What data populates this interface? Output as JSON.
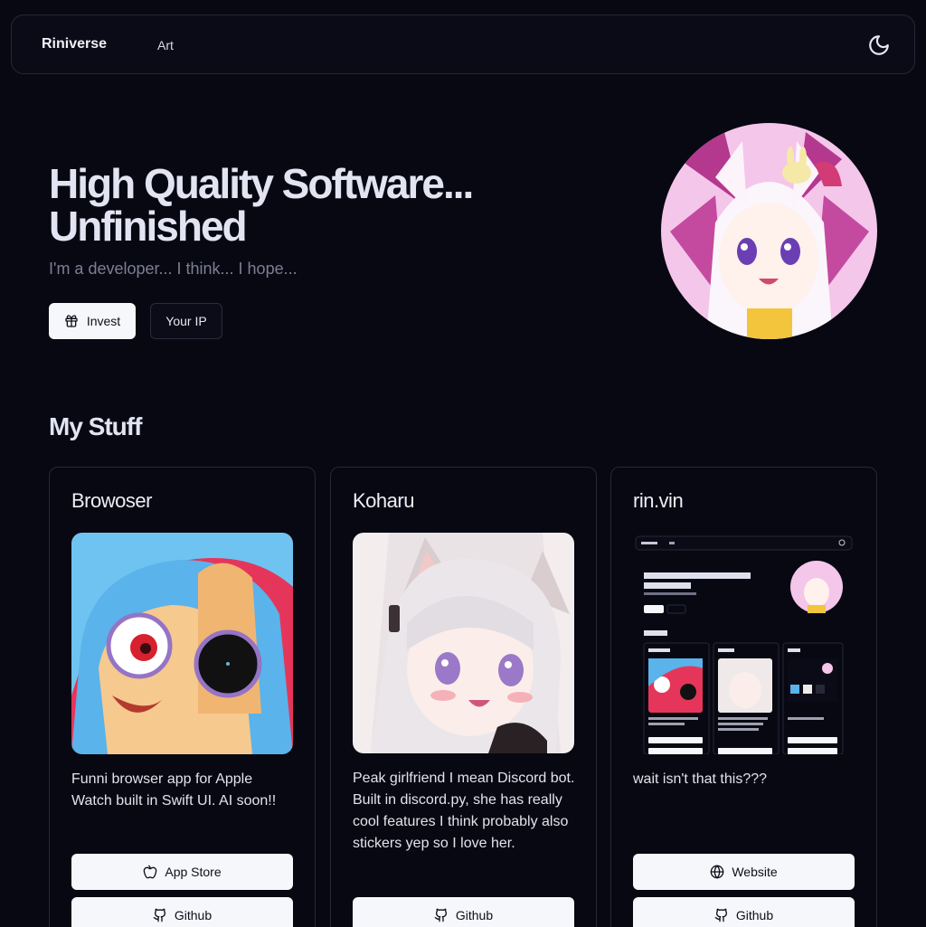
{
  "nav": {
    "brand": "Riniverse",
    "links": [
      {
        "label": "Art"
      }
    ],
    "theme_icon": "moon-icon"
  },
  "hero": {
    "title": "High Quality Software... Unfinished",
    "subtitle": "I'm a developer... I think... I hope...",
    "buttons": [
      {
        "label": "Invest",
        "icon": "gift-icon"
      },
      {
        "label": "Your IP"
      }
    ]
  },
  "section": {
    "title": "My Stuff"
  },
  "projects": [
    {
      "title": "Browoser",
      "description": "Funni browser app for Apple Watch built in Swift UI. AI soon!!",
      "buttons": [
        {
          "label": "App Store",
          "icon": "apple-icon"
        },
        {
          "label": "Github",
          "icon": "github-icon"
        }
      ]
    },
    {
      "title": "Koharu",
      "description": "Peak girlfriend I mean Discord bot. Built in discord.py, she has really cool features I think probably also stickers yep so I love her.",
      "buttons": [
        {
          "label": "Github",
          "icon": "github-icon"
        }
      ]
    },
    {
      "title": "rin.vin",
      "description": "wait isn't that this???",
      "buttons": [
        {
          "label": "Website",
          "icon": "globe-icon"
        },
        {
          "label": "Github",
          "icon": "github-icon"
        }
      ]
    }
  ],
  "colors": {
    "background": "#080812",
    "border": "#262838",
    "button_light": "#f6f7fb",
    "muted_text": "#7c7f94"
  }
}
